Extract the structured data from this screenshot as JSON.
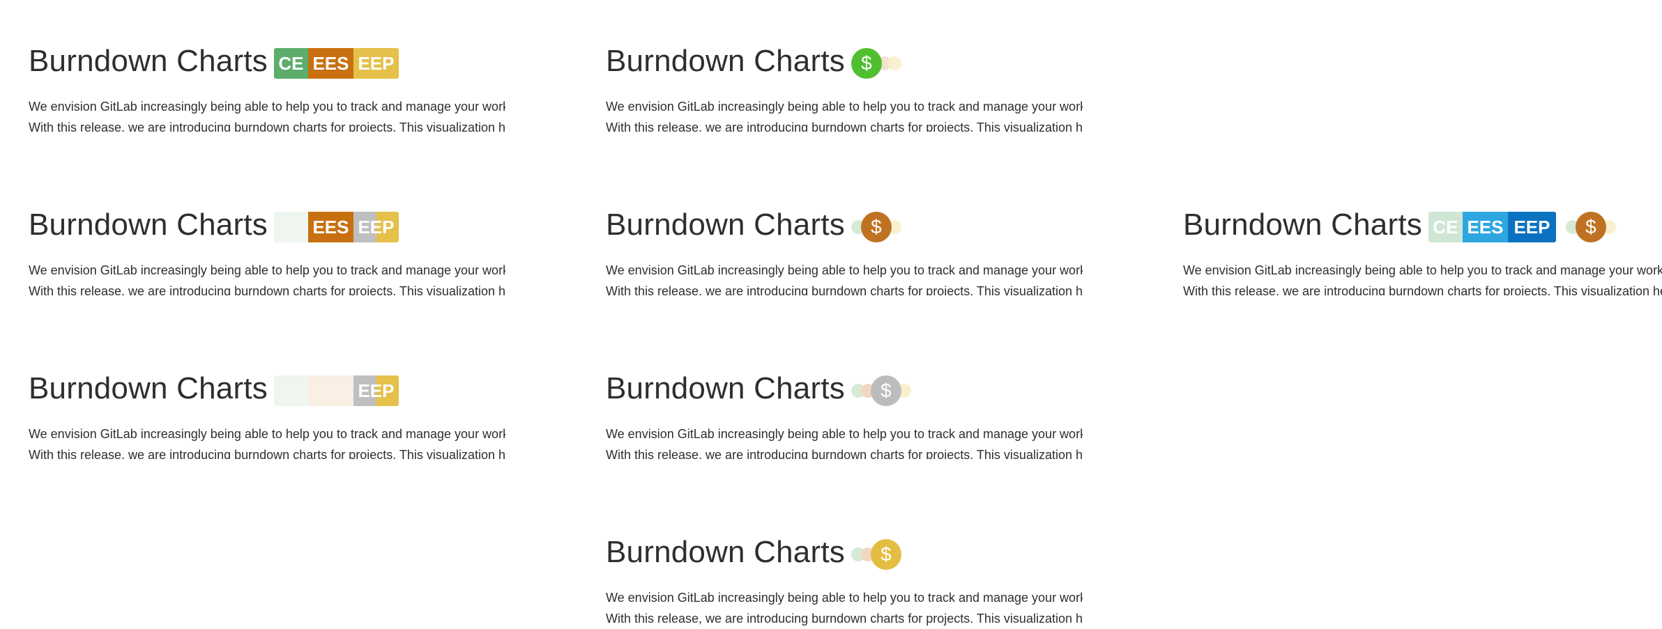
{
  "common": {
    "title": "Burndown Charts",
    "desc_line1": "We envision GitLab increasingly being able to help you to track and manage your work.",
    "desc_line2": "With this release, we are introducing burndown charts for projects. This visualization helps you to",
    "coin_symbol": "$",
    "badge_ce": "CE",
    "badge_ees": "EES",
    "badge_eep": "EEP"
  },
  "colors": {
    "ce_green": "#5cad6b",
    "ees_orange": "#c8700f",
    "eep_yellow": "#e5c04a",
    "ees_grey": "#bfbfbf",
    "ce_faded": "#eef6ef",
    "ees_faded": "#f9efe4",
    "coin_green": "#4fbf2f",
    "coin_orange": "#bf7322",
    "coin_grey": "#bcbcbc",
    "coin_yellow": "#e4be42",
    "blue_ce": "#cfe6d5",
    "blue_ees": "#2ea7e0",
    "blue_eep": "#0b72c1"
  },
  "cards": [
    {
      "id": "a1",
      "variant": "badges-full"
    },
    {
      "id": "a2",
      "variant": "coin-green"
    },
    {
      "id": "b1",
      "variant": "badges-ees-eep"
    },
    {
      "id": "b2",
      "variant": "coin-orange"
    },
    {
      "id": "b3",
      "variant": "badges-blue-coin"
    },
    {
      "id": "c1",
      "variant": "badges-eep"
    },
    {
      "id": "c2",
      "variant": "coin-grey"
    },
    {
      "id": "d2",
      "variant": "coin-yellow"
    }
  ]
}
